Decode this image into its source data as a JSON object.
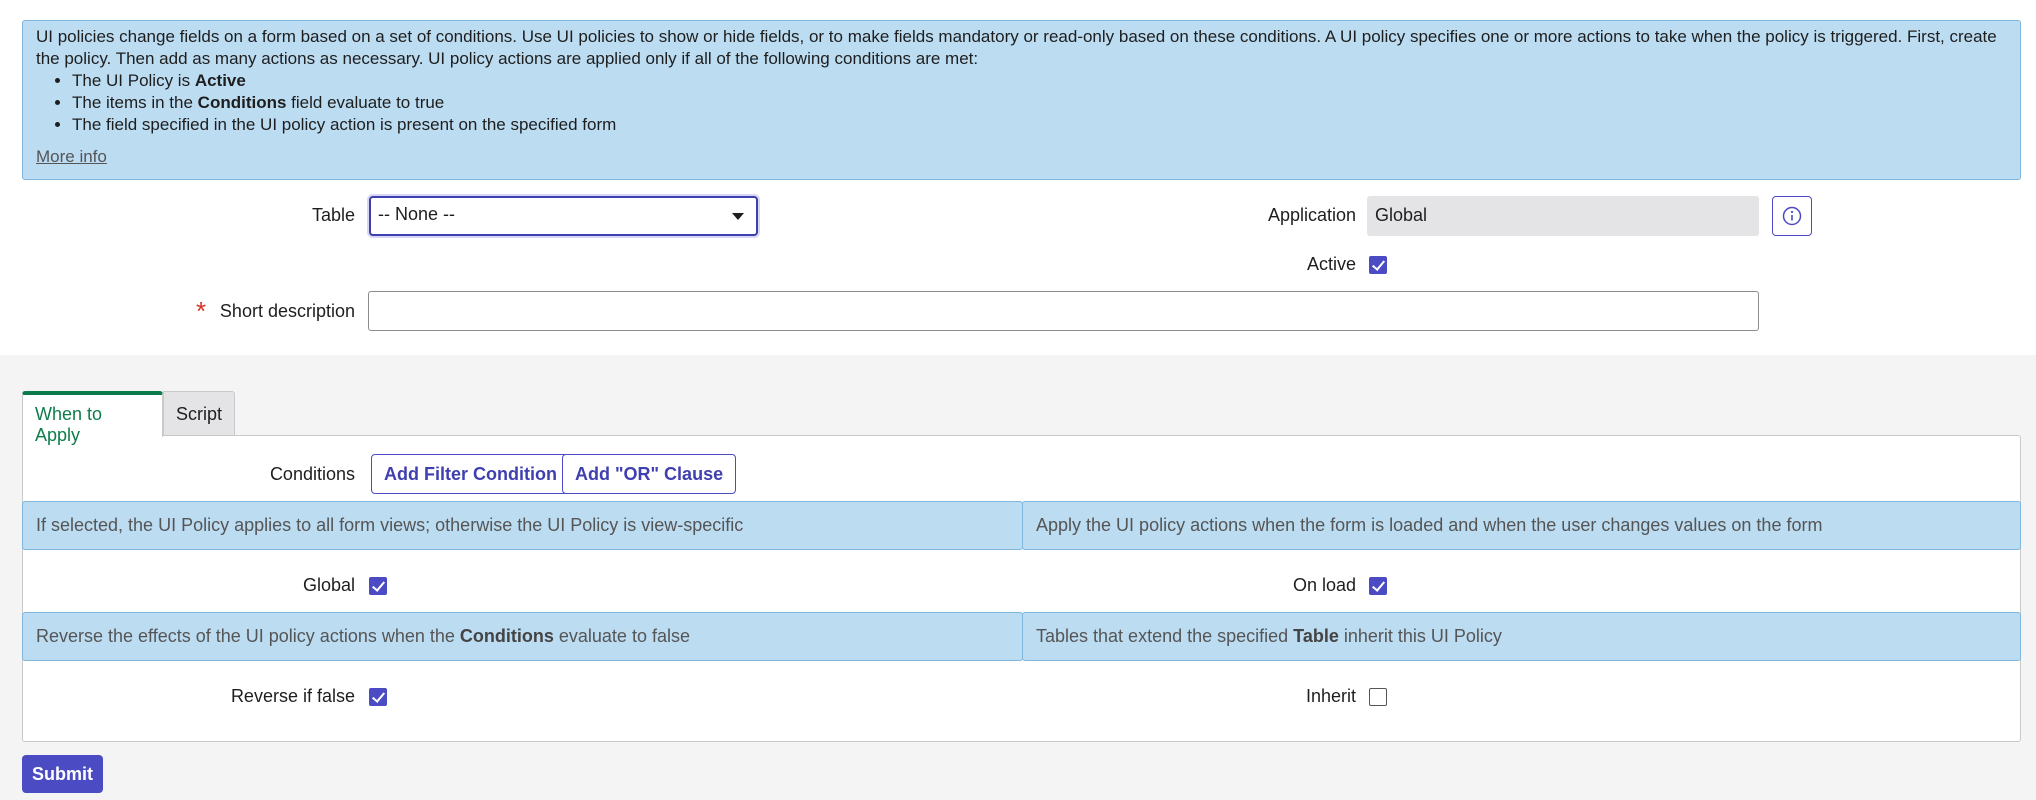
{
  "intro": {
    "text": "UI policies change fields on a form based on a set of conditions. Use UI policies to show or hide fields, or to make fields mandatory or read-only based on these conditions. A UI policy specifies one or more actions to take when the policy is triggered. First, create the policy. Then add as many actions as necessary. UI policy actions are applied only if all of the following conditions are met:",
    "bullets": [
      {
        "pre": "The UI Policy is ",
        "bold": "Active",
        "post": ""
      },
      {
        "pre": "The items in the ",
        "bold": "Conditions",
        "post": " field evaluate to true"
      },
      {
        "pre": "The field specified in the UI policy action is present on the specified form",
        "bold": "",
        "post": ""
      }
    ],
    "more_info": "More info"
  },
  "form": {
    "table_label": "Table",
    "table_value": "-- None --",
    "application_label": "Application",
    "application_value": "Global",
    "active_label": "Active",
    "active_checked": true,
    "short_description_label": "Short description",
    "short_description_value": ""
  },
  "tabs": [
    {
      "label": "When to Apply",
      "active": true
    },
    {
      "label": "Script",
      "active": false
    }
  ],
  "when_to_apply": {
    "conditions_label": "Conditions",
    "add_filter_label": "Add Filter Condition",
    "add_or_label": "Add \"OR\" Clause",
    "hint_global": "If selected, the UI Policy applies to all form views; otherwise the UI Policy is view-specific",
    "hint_onload": "Apply the UI policy actions when the form is loaded and when the user changes values on the form",
    "hint_reverse_pre": "Reverse the effects of the UI policy actions when the ",
    "hint_reverse_bold": "Conditions",
    "hint_reverse_post": " evaluate to false",
    "hint_inherit_pre": "Tables that extend the specified ",
    "hint_inherit_bold": "Table",
    "hint_inherit_post": " inherit this UI Policy",
    "global_label": "Global",
    "global_checked": true,
    "onload_label": "On load",
    "onload_checked": true,
    "reverse_label": "Reverse if false",
    "reverse_checked": true,
    "inherit_label": "Inherit",
    "inherit_checked": false
  },
  "submit_label": "Submit",
  "colors": {
    "accent": "#4b4bc4",
    "info_bg": "#bcdcf2",
    "tab_active": "#0e7c4a",
    "required": "#d93025"
  }
}
